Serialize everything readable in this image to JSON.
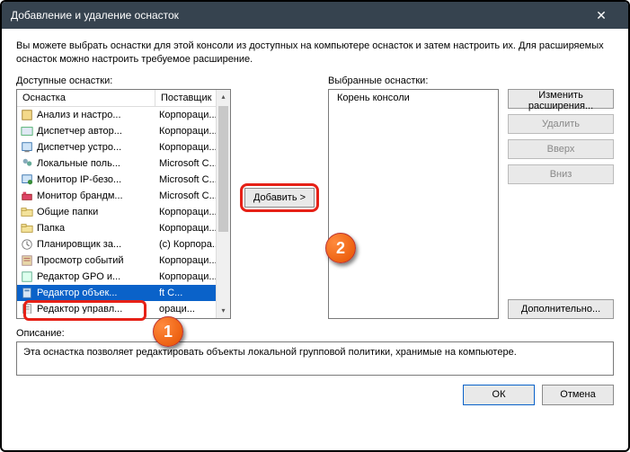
{
  "title": "Добавление и удаление оснасток",
  "intro": "Вы можете выбрать оснастки для этой консоли из доступных на компьютере оснасток и затем настроить их. Для расширяемых оснасток можно настроить требуемое расширение.",
  "labels": {
    "available": "Доступные оснастки:",
    "selected": "Выбранные оснастки:",
    "description": "Описание:"
  },
  "columns": {
    "snapin": "Оснастка",
    "vendor": "Поставщик"
  },
  "snapins": [
    {
      "name": "Анализ и настро...",
      "vendor": "Корпораци..."
    },
    {
      "name": "Диспетчер автор...",
      "vendor": "Корпораци..."
    },
    {
      "name": "Диспетчер устро...",
      "vendor": "Корпораци..."
    },
    {
      "name": "Локальные поль...",
      "vendor": "Microsoft C..."
    },
    {
      "name": "Монитор IP-безо...",
      "vendor": "Microsoft C..."
    },
    {
      "name": "Монитор брандм...",
      "vendor": "Microsoft C..."
    },
    {
      "name": "Общие папки",
      "vendor": "Корпораци..."
    },
    {
      "name": "Папка",
      "vendor": "Корпораци..."
    },
    {
      "name": "Планировщик за...",
      "vendor": "(с) Корпора..."
    },
    {
      "name": "Просмотр событий",
      "vendor": "Корпораци..."
    },
    {
      "name": "Редактор GPO и...",
      "vendor": "Корпораци..."
    },
    {
      "name": "Редактор объек...",
      "vendor": "    ft C..."
    },
    {
      "name": "Редактор управл...",
      "vendor": "    ораци..."
    }
  ],
  "selected_index": 11,
  "add_button": "Добавить >",
  "tree_root": "Корень консоли",
  "side": {
    "edit_ext": "Изменить расширения...",
    "remove": "Удалить",
    "up": "Вверх",
    "down": "Вниз",
    "advanced": "Дополнительно..."
  },
  "description_text": "Эта оснастка позволяет редактировать объекты локальной групповой политики, хранимые на компьютере.",
  "footer": {
    "ok": "ОК",
    "cancel": "Отмена"
  },
  "markers": {
    "m1": "1",
    "m2": "2"
  }
}
